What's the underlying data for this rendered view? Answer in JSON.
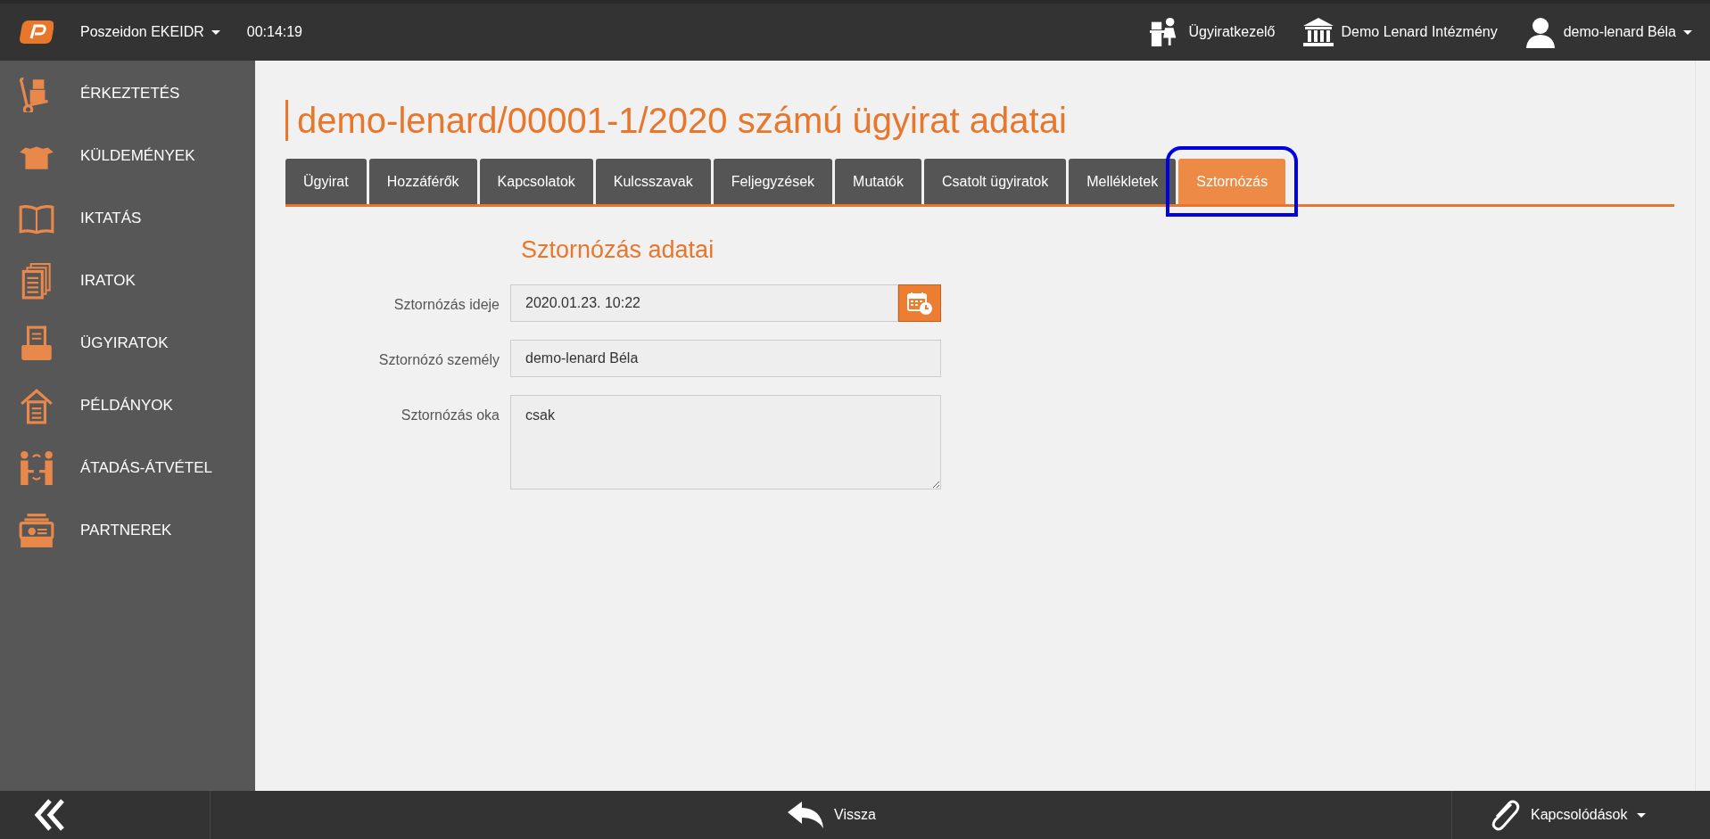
{
  "topbar": {
    "app_menu": "Poszeidon EKEIDR",
    "timer": "00:14:19",
    "role": "Ügyiratkezelő",
    "institution": "Demo Lenard Intézmény",
    "user": "demo-lenard Béla"
  },
  "sidebar": {
    "items": [
      {
        "label": "ÉRKEZTETÉS",
        "kind": "trolley"
      },
      {
        "label": "KÜLDEMÉNYEK",
        "kind": "box"
      },
      {
        "label": "IKTATÁS",
        "kind": "book"
      },
      {
        "label": "IRATOK",
        "kind": "docs"
      },
      {
        "label": "ÜGYIRATOK",
        "kind": "tray"
      },
      {
        "label": "PÉLDÁNYOK",
        "kind": "house"
      },
      {
        "label": "ÁTADÁS-ÁTVÉTEL",
        "kind": "people"
      },
      {
        "label": "PARTNEREK",
        "kind": "cards"
      }
    ]
  },
  "page_title": "demo-lenard/00001-1/2020 számú ügyirat adatai",
  "tabs": [
    {
      "label": "Ügyirat",
      "selected": false,
      "highlighted": false
    },
    {
      "label": "Hozzáférők",
      "selected": false,
      "highlighted": false
    },
    {
      "label": "Kapcsolatok",
      "selected": false,
      "highlighted": false
    },
    {
      "label": "Kulcsszavak",
      "selected": false,
      "highlighted": false
    },
    {
      "label": "Feljegyzések",
      "selected": false,
      "highlighted": false
    },
    {
      "label": "Mutatók",
      "selected": false,
      "highlighted": false
    },
    {
      "label": "Csatolt ügyiratok",
      "selected": false,
      "highlighted": false
    },
    {
      "label": "Mellékletek",
      "selected": false,
      "highlighted": false
    },
    {
      "label": "Sztornózás",
      "selected": true,
      "highlighted": true
    }
  ],
  "section_title": "Sztornózás adatai",
  "fields": [
    {
      "label": "Sztornózás ideje",
      "value": "2020.01.23. 10:22",
      "kind": "datetime"
    },
    {
      "label": "Sztornózó személy",
      "value": "demo-lenard Béla",
      "kind": "text"
    },
    {
      "label": "Sztornózás oka",
      "value": "csak",
      "kind": "textarea"
    }
  ],
  "bottombar": {
    "back": "Vissza",
    "links": "Kapcsolódások"
  }
}
